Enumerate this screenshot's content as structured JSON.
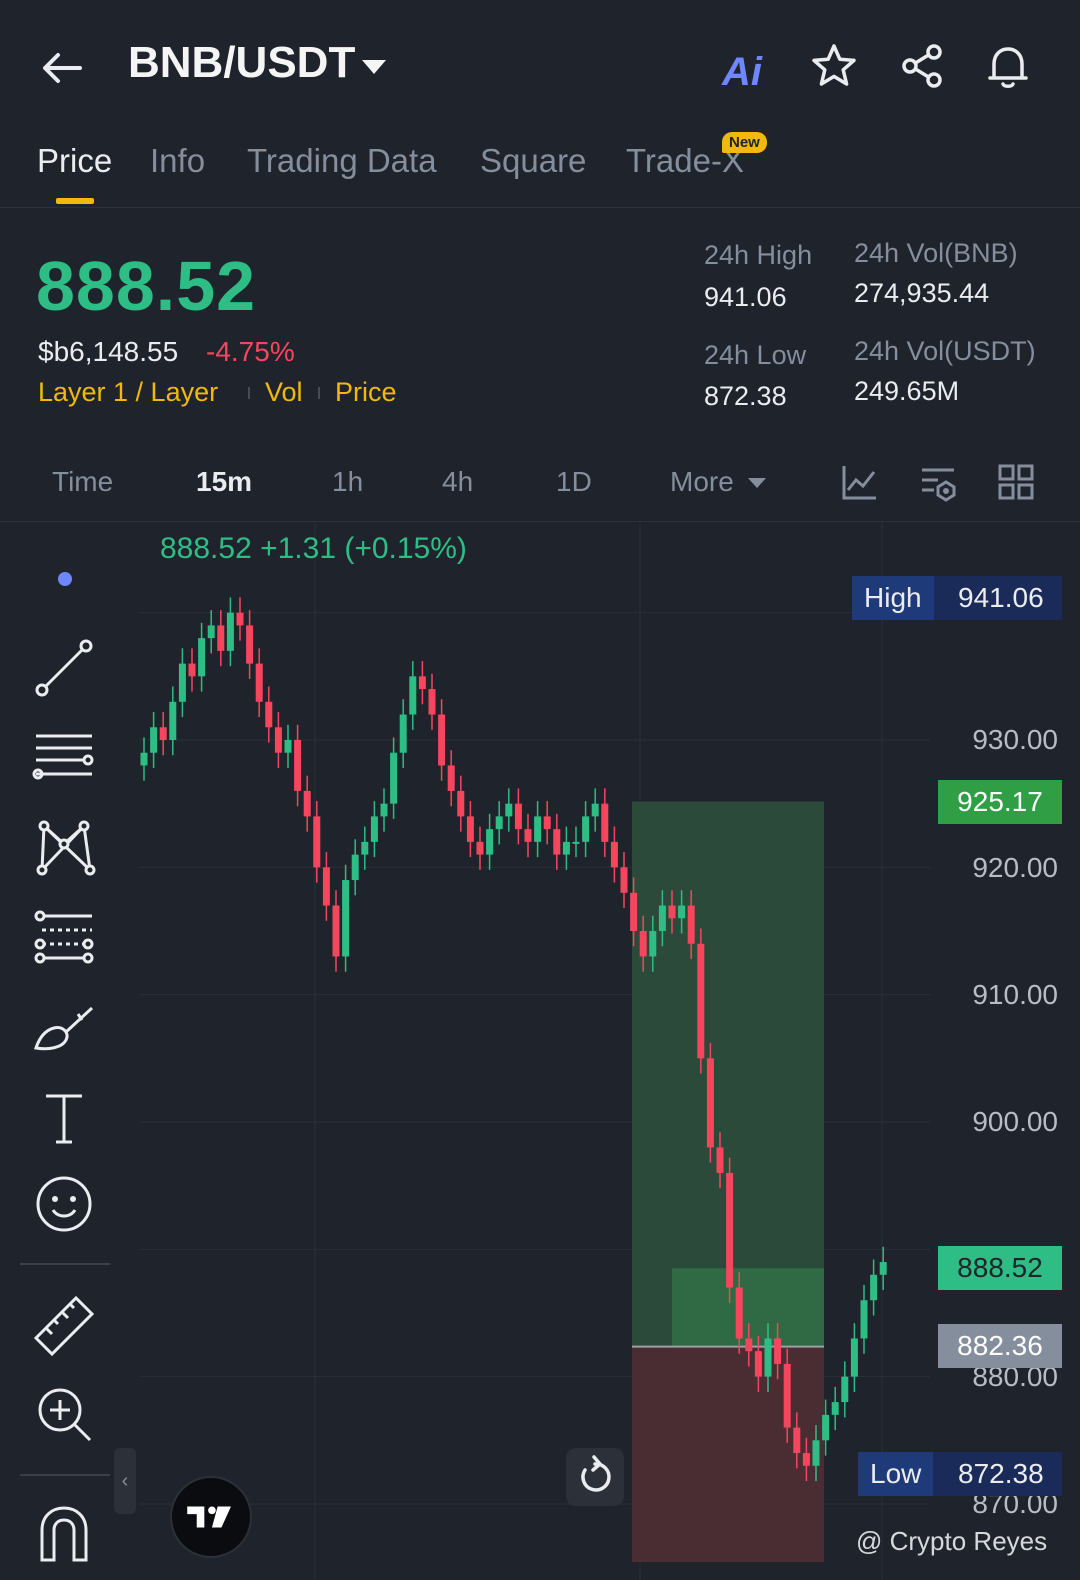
{
  "header": {
    "pair": "BNB/USDT",
    "ai_label": "Ai"
  },
  "tabs": [
    {
      "label": "Price",
      "active": true
    },
    {
      "label": "Info"
    },
    {
      "label": "Trading Data"
    },
    {
      "label": "Square"
    },
    {
      "label": "Trade-X",
      "badge": "New"
    }
  ],
  "ticker": {
    "last_price": "888.52",
    "usd_price": "$b6,148.55",
    "change_pct": "-4.75%",
    "tags": [
      "Layer 1 / Layer",
      "Vol",
      "Price"
    ],
    "high_label": "24h High",
    "high": "941.06",
    "low_label": "24h Low",
    "low": "872.38",
    "vol_base_label": "24h Vol(BNB)",
    "vol_base": "274,935.44",
    "vol_quote_label": "24h Vol(USDT)",
    "vol_quote": "249.65M"
  },
  "intervals": {
    "items": [
      "Time",
      "15m",
      "1h",
      "4h",
      "1D",
      "More"
    ],
    "active": "15m"
  },
  "chart": {
    "ohlc_summary": "888.52  +1.31 (+0.15%)",
    "axis_labels": [
      "930.00",
      "920.00",
      "910.00",
      "900.00",
      "880.00",
      "870.00"
    ],
    "high_tag": {
      "label": "High",
      "value": "941.06"
    },
    "low_tag": {
      "label": "Low",
      "value": "872.38"
    },
    "target_price": "925.17",
    "current_price": "888.52",
    "entry_price": "882.36",
    "watermark": "@ Crypto Reyes",
    "colors": {
      "up": "#2ebd85",
      "down": "#f6465d",
      "accent": "#f0b90b"
    }
  }
}
